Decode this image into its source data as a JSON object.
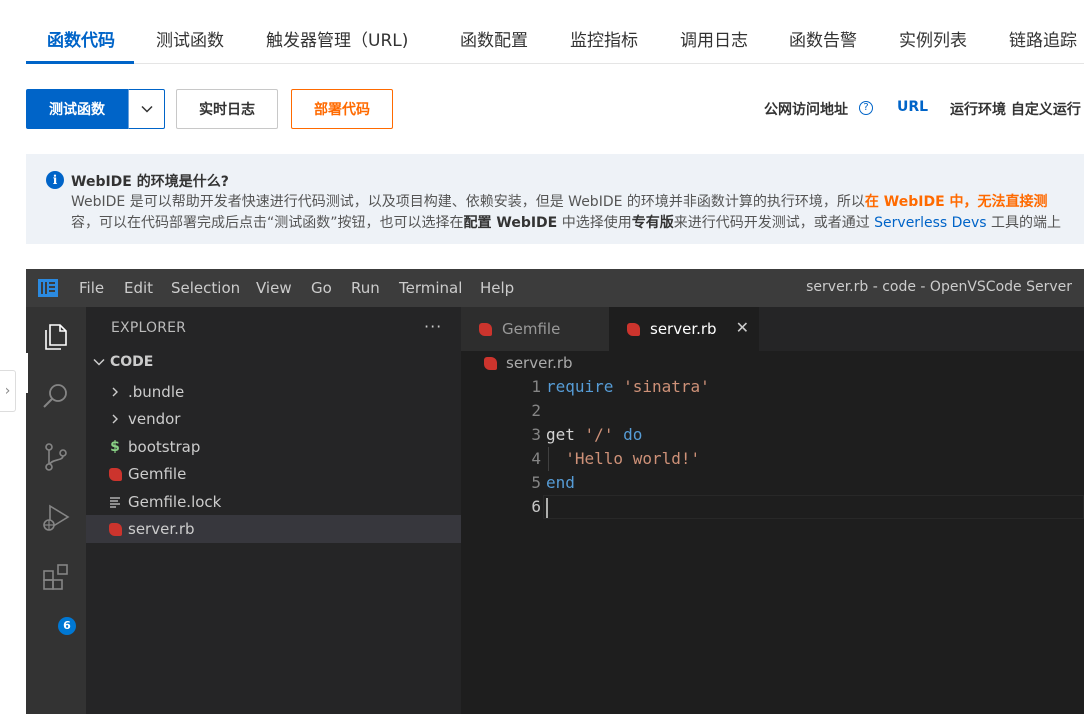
{
  "tabs": [
    {
      "label": "函数代码",
      "active": true
    },
    {
      "label": "测试函数"
    },
    {
      "label": "触发器管理（URL)"
    },
    {
      "label": "函数配置"
    },
    {
      "label": "监控指标"
    },
    {
      "label": "调用日志"
    },
    {
      "label": "函数告警"
    },
    {
      "label": "实例列表"
    },
    {
      "label": "链路追踪"
    }
  ],
  "toolbar": {
    "test_label": "测试函数",
    "realtime_log_label": "实时日志",
    "deploy_label": "部署代码",
    "public_url_label": "公网访问地址",
    "url_link": "URL",
    "runtime_label": "运行环境 自定义运行"
  },
  "notice": {
    "title": "WebIDE 的环境是什么?",
    "line1_a": "WebIDE 是可以帮助开发者快速进行代码测试，以及项目构建、依赖安装，但是 WebIDE 的环境并非函数计算的执行环境，所以",
    "line1_b": "在 WebIDE 中，无法直接测",
    "line2_a": "容，可以在代码部署完成后点击“测试函数”按钮，也可以选择在",
    "line2_b": "配置 WebIDE",
    "line2_c": " 中选择使用",
    "line2_d": "专有版",
    "line2_e": "来进行代码开发测试，或者通过 ",
    "line2_f": "Serverless Devs",
    "line2_g": " 工具的端上"
  },
  "vscode": {
    "menu": [
      "File",
      "Edit",
      "Selection",
      "View",
      "Go",
      "Run",
      "Terminal",
      "Help"
    ],
    "window_title": "server.rb - code - OpenVSCode Server",
    "extensions_badge": "6",
    "explorer_title": "EXPLORER",
    "explorer_more": "···",
    "folder": "CODE",
    "tree": [
      {
        "label": ".bundle",
        "icon": "chevron-right-icon"
      },
      {
        "label": "vendor",
        "icon": "chevron-right-icon"
      },
      {
        "label": "bootstrap",
        "icon": "dollar-icon"
      },
      {
        "label": "Gemfile",
        "icon": "ruby-icon"
      },
      {
        "label": "Gemfile.lock",
        "icon": "lines-icon"
      },
      {
        "label": "server.rb",
        "icon": "ruby-icon",
        "selected": true
      }
    ],
    "editor_tabs": [
      {
        "label": "Gemfile",
        "active": false
      },
      {
        "label": "server.rb",
        "active": true
      }
    ],
    "close_glyph": "✕",
    "breadcrumb": "server.rb",
    "line_numbers": [
      "1",
      "2",
      "3",
      "4",
      "5",
      "6"
    ],
    "code": {
      "l1_kw": "require",
      "l1_str": "'sinatra'",
      "l3_plain": "get",
      "l3_str": "'/'",
      "l3_kw": "do",
      "l4_str": "'Hello world!'",
      "l5_kw": "end"
    },
    "colors": {
      "keyword": "#569cd6",
      "string": "#ce9178",
      "ruby": "#cc342d",
      "accent": "#0064c8",
      "deploy": "#ff6a00"
    }
  }
}
